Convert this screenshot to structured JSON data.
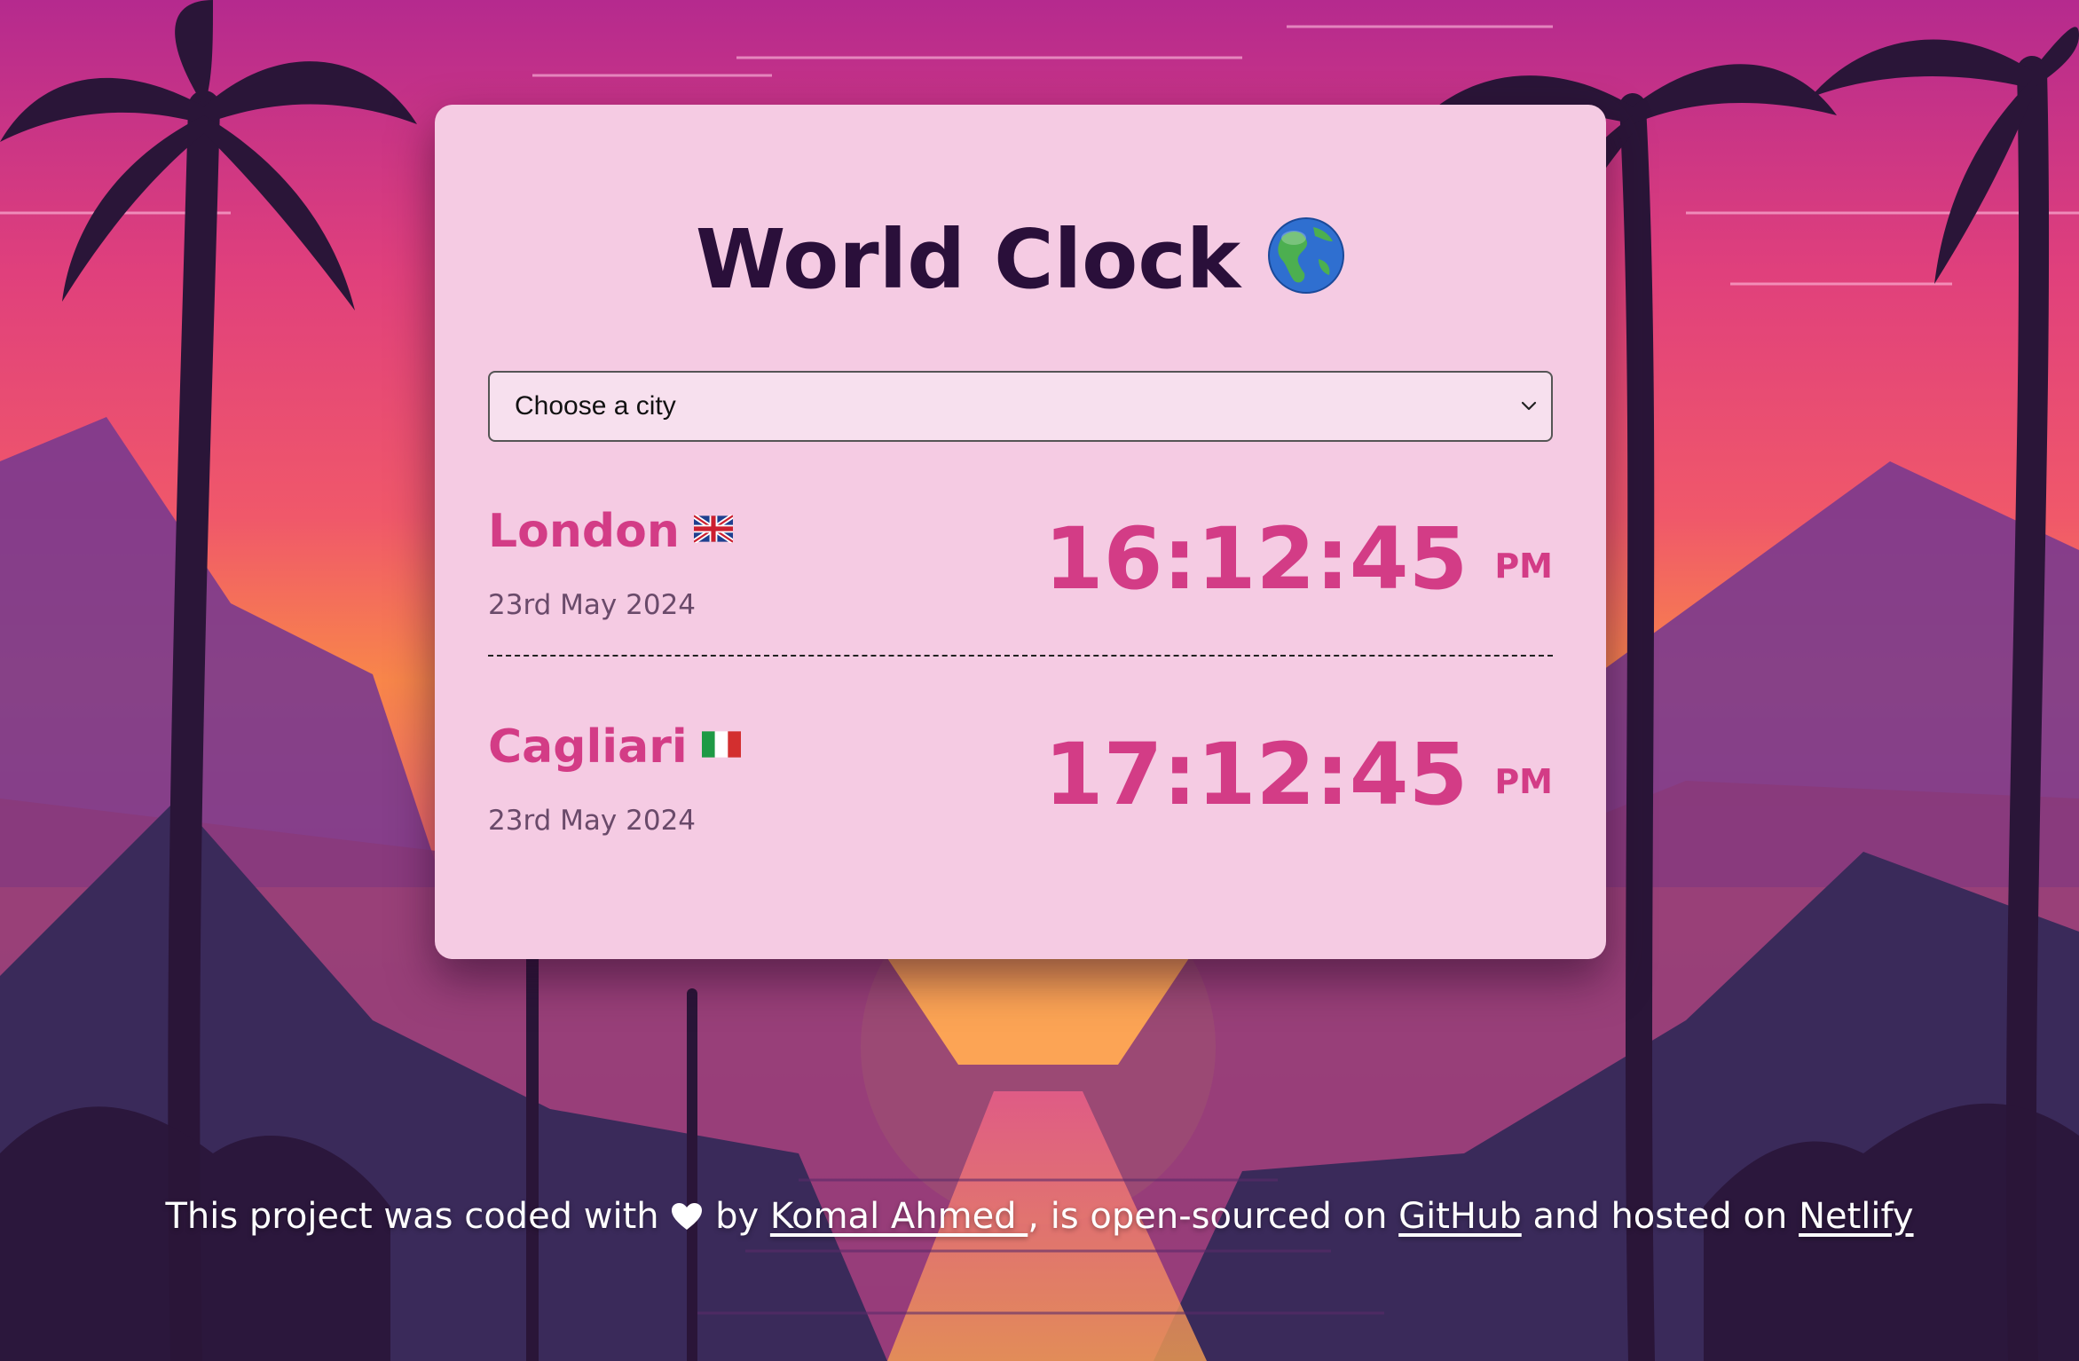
{
  "header": {
    "title": "World Clock",
    "title_icon": "globe-americas-icon"
  },
  "city_select": {
    "selected": "Choose a city",
    "icon": "chevron-down-icon"
  },
  "cities": [
    {
      "name": "London",
      "flag_icon": "uk-flag-icon",
      "date": "23rd May 2024",
      "time": "16:12:45",
      "ampm": "PM"
    },
    {
      "name": "Cagliari",
      "flag_icon": "italy-flag-icon",
      "date": "23rd May 2024",
      "time": "17:12:45",
      "ampm": "PM"
    }
  ],
  "footer": {
    "text_1": "This project was coded with",
    "heart_icon": "white-heart-icon",
    "text_2": "by",
    "author_link": "Komal Ahmed ",
    "text_3": ", is open-sourced on",
    "github_link": "GitHub",
    "text_4": "and hosted on",
    "netlify_link": "Netlify"
  },
  "colors": {
    "card_bg": "#f5cbe3",
    "accent": "#d33c86",
    "title": "#2a0f3a",
    "date": "#6a4a6a"
  }
}
